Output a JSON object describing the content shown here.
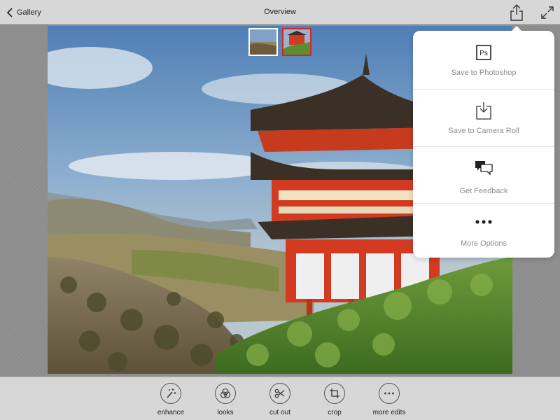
{
  "header": {
    "back_label": "Gallery",
    "title": "Overview"
  },
  "popover": {
    "items": [
      {
        "icon": "photoshop-icon",
        "icon_text": "Ps",
        "label": "Save to Photoshop"
      },
      {
        "icon": "download-icon",
        "label": "Save to Camera Roll"
      },
      {
        "icon": "speech-bubbles-icon",
        "label": "Get Feedback"
      },
      {
        "icon": "ellipsis-icon",
        "label": "More Options"
      }
    ]
  },
  "toolbar": {
    "items": [
      {
        "icon": "magic-wand-icon",
        "label": "enhance"
      },
      {
        "icon": "looks-circles-icon",
        "label": "looks"
      },
      {
        "icon": "scissors-icon",
        "label": "cut out"
      },
      {
        "icon": "crop-icon",
        "label": "crop"
      },
      {
        "icon": "ellipsis-icon",
        "label": "more edits"
      }
    ]
  },
  "thumbnails": [
    {
      "name": "landscape",
      "selected": false
    },
    {
      "name": "pagoda",
      "selected": true
    }
  ],
  "colors": {
    "accent_selected": "#d8232a",
    "bar": "#d7d7d7",
    "pagoda_red": "#d23b22"
  }
}
